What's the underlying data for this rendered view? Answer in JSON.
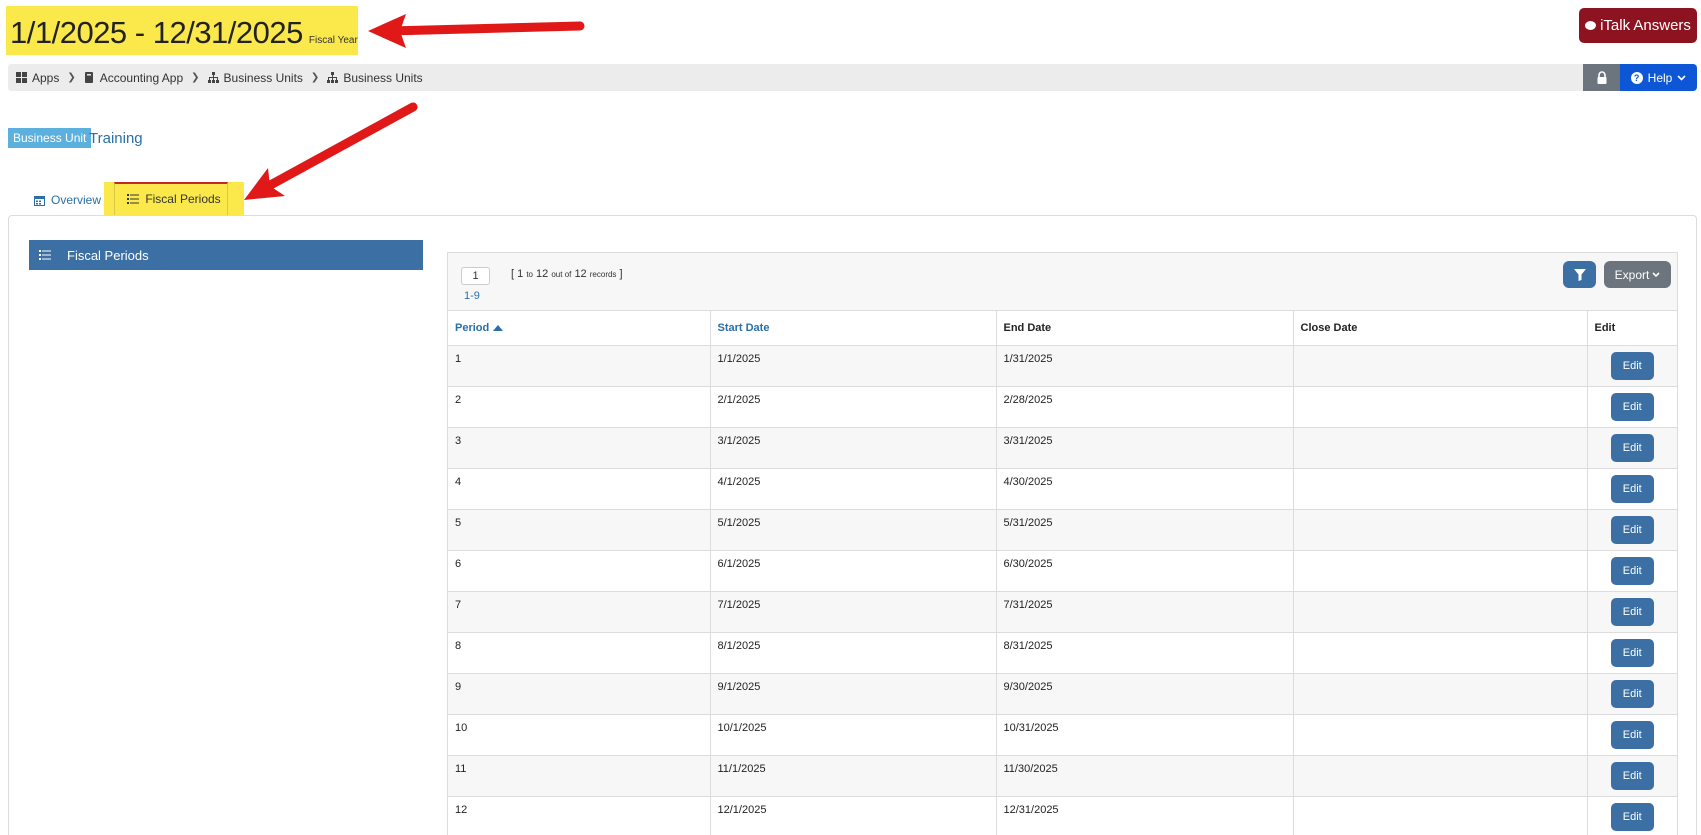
{
  "header": {
    "fiscal_year_range": "1/1/2025 - 12/31/2025",
    "fiscal_year_label": "Fiscal Year",
    "italk_label": "iTalk Answers"
  },
  "breadcrumb": {
    "items": [
      "Apps",
      "Accounting App",
      "Business Units",
      "Business Units"
    ],
    "icons": [
      "grid-icon",
      "book-icon",
      "sitemap-icon",
      "sitemap-icon"
    ],
    "help_label": "Help"
  },
  "business_unit": {
    "badge": "Business Unit",
    "name": "Training"
  },
  "tabs": [
    {
      "label": "Overview",
      "icon": "calendar-icon"
    },
    {
      "label": "Fiscal Periods",
      "icon": "list-icon"
    }
  ],
  "sidebar": {
    "heading": "Fiscal Periods"
  },
  "grid": {
    "page": "1",
    "page_range": "1-9",
    "records": {
      "from": "1",
      "to_word": "to",
      "to": "12",
      "outof_word": "out of",
      "total": "12",
      "records_word": "records"
    },
    "export_label": "Export",
    "columns": [
      "Period",
      "Start Date",
      "End Date",
      "Close Date",
      "Edit"
    ],
    "edit_label": "Edit",
    "rows": [
      {
        "period": "1",
        "start": "1/1/2025",
        "end": "1/31/2025",
        "close": ""
      },
      {
        "period": "2",
        "start": "2/1/2025",
        "end": "2/28/2025",
        "close": ""
      },
      {
        "period": "3",
        "start": "3/1/2025",
        "end": "3/31/2025",
        "close": ""
      },
      {
        "period": "4",
        "start": "4/1/2025",
        "end": "4/30/2025",
        "close": ""
      },
      {
        "period": "5",
        "start": "5/1/2025",
        "end": "5/31/2025",
        "close": ""
      },
      {
        "period": "6",
        "start": "6/1/2025",
        "end": "6/30/2025",
        "close": ""
      },
      {
        "period": "7",
        "start": "7/1/2025",
        "end": "7/31/2025",
        "close": ""
      },
      {
        "period": "8",
        "start": "8/1/2025",
        "end": "8/31/2025",
        "close": ""
      },
      {
        "period": "9",
        "start": "9/1/2025",
        "end": "9/30/2025",
        "close": ""
      },
      {
        "period": "10",
        "start": "10/1/2025",
        "end": "10/31/2025",
        "close": ""
      },
      {
        "period": "11",
        "start": "11/1/2025",
        "end": "11/30/2025",
        "close": ""
      },
      {
        "period": "12",
        "start": "12/1/2025",
        "end": "12/31/2025",
        "close": ""
      }
    ]
  },
  "colors": {
    "highlight": "#fbe84a",
    "arrow": "#e01818",
    "primary": "#3c6fa3",
    "italk": "#8e1320",
    "help": "#0d57d6"
  }
}
